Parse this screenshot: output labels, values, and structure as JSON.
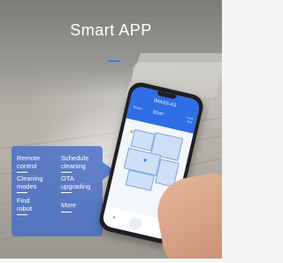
{
  "title": "Smart APP",
  "features": [
    {
      "line1": "Remote",
      "line2": "control"
    },
    {
      "line1": "Schedule",
      "line2": "cleaning"
    },
    {
      "line1": "Cleaning",
      "line2": "modes"
    },
    {
      "line1": "OTA",
      "line2": "upgrading"
    },
    {
      "line1": "Find",
      "line2": "robot"
    },
    {
      "line1": "More",
      "line2": ""
    }
  ],
  "phone": {
    "app_title": "IMASS-A3",
    "area": "81m²",
    "left_label": "Battery",
    "right_label1": "72min",
    "right_label2": "time"
  },
  "colors": {
    "accent": "#2f7ff0",
    "panel": "#466ec8",
    "app_header": "#2f6de6"
  }
}
